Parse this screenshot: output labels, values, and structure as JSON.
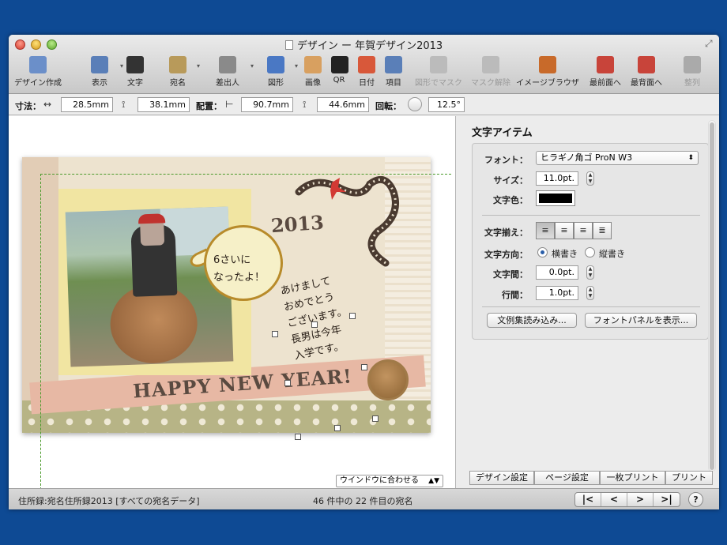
{
  "window": {
    "title": "デザイン ー 年賀デザイン2013"
  },
  "toolbar": {
    "items": [
      {
        "label": "デザイン作成",
        "icon": "design-create-icon"
      },
      {
        "label": "表示",
        "icon": "view-icon"
      },
      {
        "label": "文字",
        "icon": "text-icon"
      },
      {
        "label": "宛名",
        "icon": "address-icon"
      },
      {
        "label": "差出人",
        "icon": "sender-icon"
      },
      {
        "label": "図形",
        "icon": "shape-icon"
      },
      {
        "label": "画像",
        "icon": "image-icon"
      },
      {
        "label": "QR",
        "icon": "qr-icon"
      },
      {
        "label": "日付",
        "icon": "calendar-icon"
      },
      {
        "label": "項目",
        "icon": "field-icon"
      },
      {
        "label": "図形でマスク",
        "icon": "mask-shape-icon"
      },
      {
        "label": "マスク解除",
        "icon": "mask-remove-icon"
      },
      {
        "label": "イメージブラウザ",
        "icon": "image-browser-icon"
      },
      {
        "label": "最前面へ",
        "icon": "bring-front-icon"
      },
      {
        "label": "最背面へ",
        "icon": "send-back-icon"
      },
      {
        "label": "整列",
        "icon": "align-icon"
      }
    ]
  },
  "dimensions": {
    "size_label": "寸法：",
    "width": "28.5mm",
    "height": "38.1mm",
    "position_label": "配置：",
    "x": "90.7mm",
    "y": "44.6mm",
    "rotation_label": "回転：",
    "rotation": "12.5°"
  },
  "card": {
    "bubble_text": "6さいに\nなったよ！",
    "year": "2013",
    "greeting": "あけまして\nおめでとう\nございます。\n長男は今年\n入学です。",
    "happy_new_year": "HAPPY NEW YEAR!"
  },
  "canvas": {
    "zoom_option": "ウインドウに合わせる"
  },
  "panel": {
    "title": "文字アイテム",
    "font_label": "フォント：",
    "font_value": "ヒラギノ角ゴ ProN W3",
    "size_label": "サイズ：",
    "size_value": "11.0pt.",
    "color_label": "文字色：",
    "color_value": "#000000",
    "align_label": "文字揃え：",
    "direction_label": "文字方向：",
    "direction_horizontal": "横書き",
    "direction_vertical": "縦書き",
    "char_spacing_label": "文字間：",
    "char_spacing_value": "0.0pt.",
    "line_spacing_label": "行間：",
    "line_spacing_value": "1.0pt.",
    "import_button": "文例集読み込み...",
    "font_panel_button": "フォントパネルを表示..."
  },
  "bottom_tabs": [
    "デザイン設定",
    "ページ設定",
    "一枚プリント",
    "プリント"
  ],
  "status": {
    "address_book": "住所録:宛名住所録2013 [すべての宛名データ]",
    "record_info": "46 件中の 22 件目の宛名"
  }
}
